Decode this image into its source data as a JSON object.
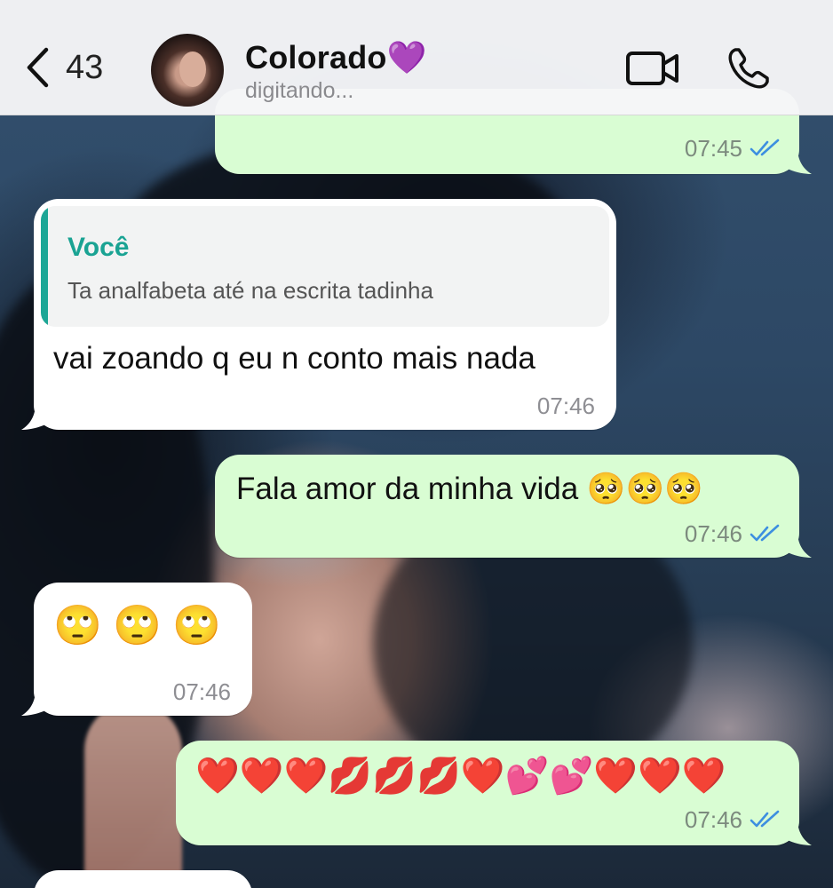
{
  "header": {
    "back_count": "43",
    "contact_name": "Colorado💜",
    "contact_status": "digitando..."
  },
  "messages": [
    {
      "direction": "out",
      "text": "",
      "time": "07:45",
      "read": true
    },
    {
      "direction": "in",
      "quote_author": "Você",
      "quote_text": "Ta analfabeta até na escrita tadinha",
      "text": "vai zoando q eu n conto mais nada",
      "time": "07:46"
    },
    {
      "direction": "out",
      "text": "Fala amor da minha vida 🥺🥺🥺",
      "time": "07:46",
      "read": true
    },
    {
      "direction": "in",
      "text": "🙄 🙄 🙄",
      "time": "07:46"
    },
    {
      "direction": "out",
      "text": "❤️❤️❤️💋💋💋❤️💕💕❤️❤️❤️",
      "time": "07:46",
      "read": true
    }
  ],
  "colors": {
    "outgoing_bubble": "#d9fdd3",
    "incoming_bubble": "#ffffff",
    "quote_accent": "#1da696",
    "read_ticks": "#3d8fe0"
  },
  "icons": {
    "back": "chevron-left-icon",
    "video": "video-camera-icon",
    "call": "phone-icon",
    "read_receipt": "double-check-icon"
  }
}
